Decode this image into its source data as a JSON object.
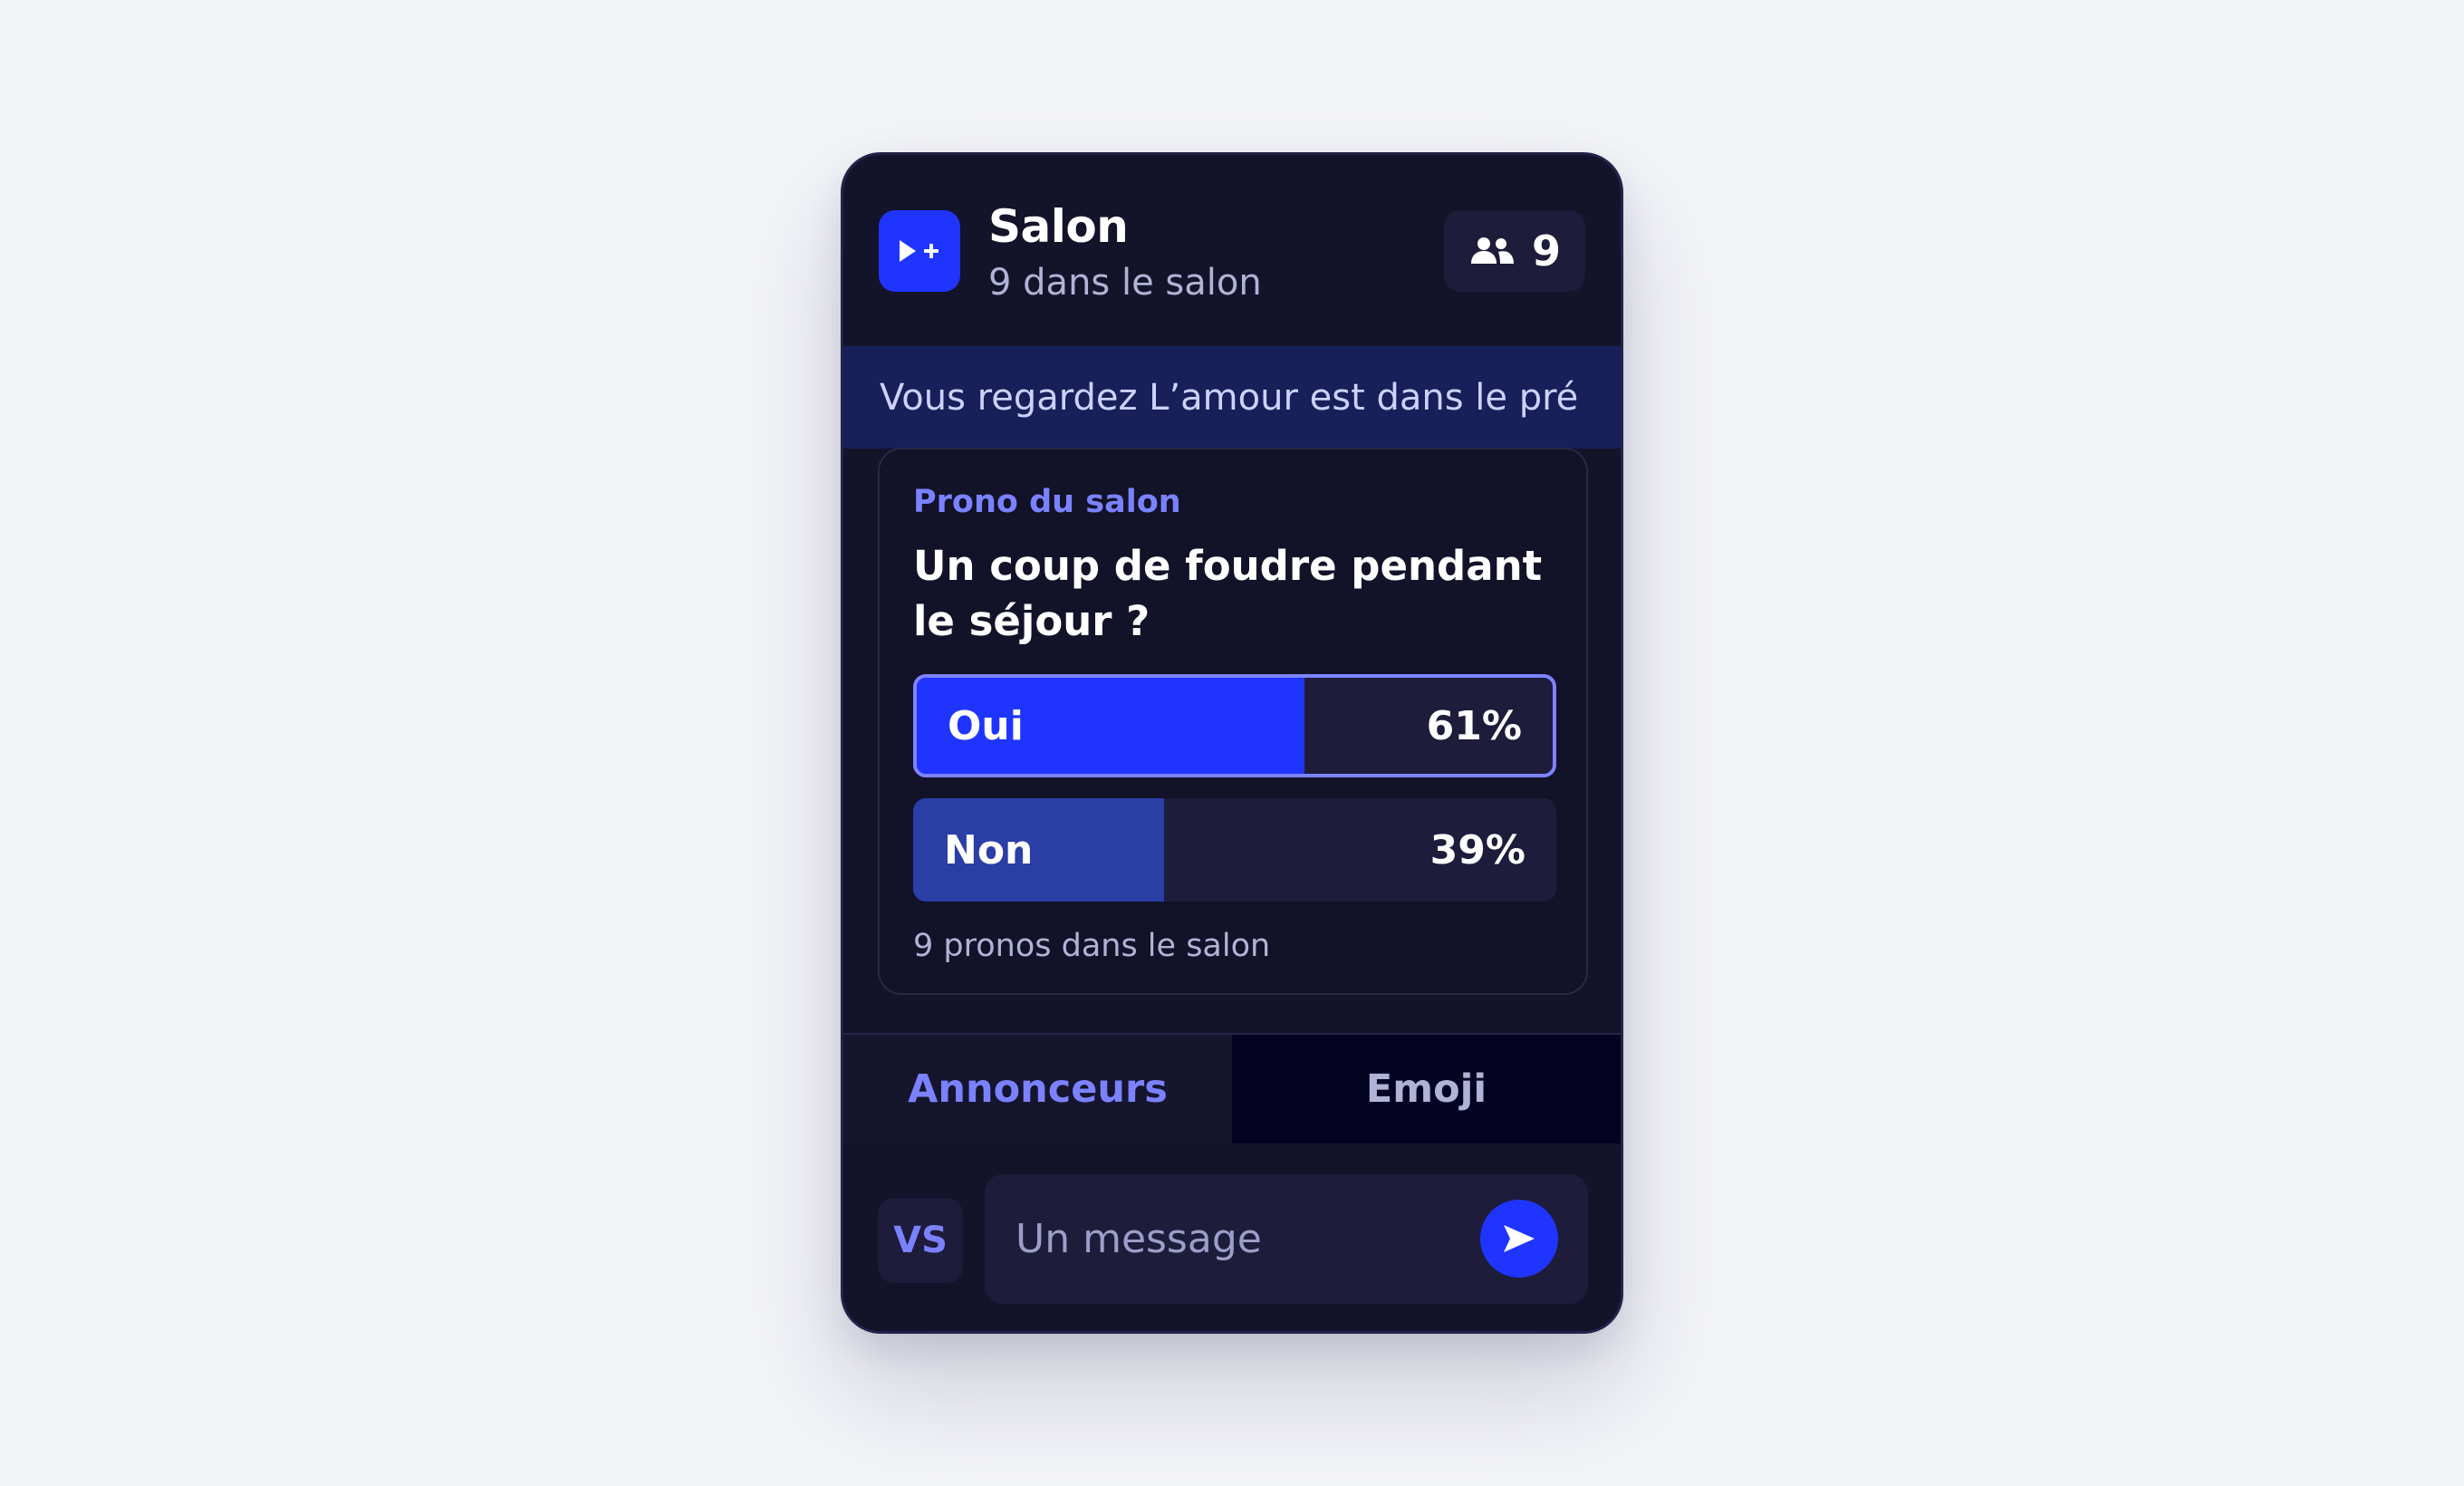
{
  "header": {
    "title": "Salon",
    "subtitle": "9 dans le salon",
    "viewer_count": "9",
    "logo_icon": "play-plus-icon",
    "viewers_icon": "users-icon"
  },
  "banner": {
    "text": "Vous regardez L’amour est dans le pré"
  },
  "poll": {
    "label": "Prono du salon",
    "question": "Un coup de foudre pendant le séjour ?",
    "options": [
      {
        "label": "Oui",
        "percent_text": "61%",
        "percent": 61,
        "selected": true
      },
      {
        "label": "Non",
        "percent_text": "39%",
        "percent": 39,
        "selected": false
      }
    ],
    "footer": "9 pronos dans le salon"
  },
  "tabs": [
    {
      "label": "Annonceurs",
      "active": true
    },
    {
      "label": "Emoji",
      "active": false
    }
  ],
  "composer": {
    "avatar_initials": "VS",
    "placeholder": "Un message",
    "value": "",
    "send_icon": "send-icon"
  },
  "colors": {
    "accent": "#1f35ff",
    "accent_dim": "#2b3ea6",
    "accent_text": "#7b82ff",
    "card_bg": "#13132a",
    "banner_bg": "#172059",
    "page_bg": "#f3f4f8"
  }
}
